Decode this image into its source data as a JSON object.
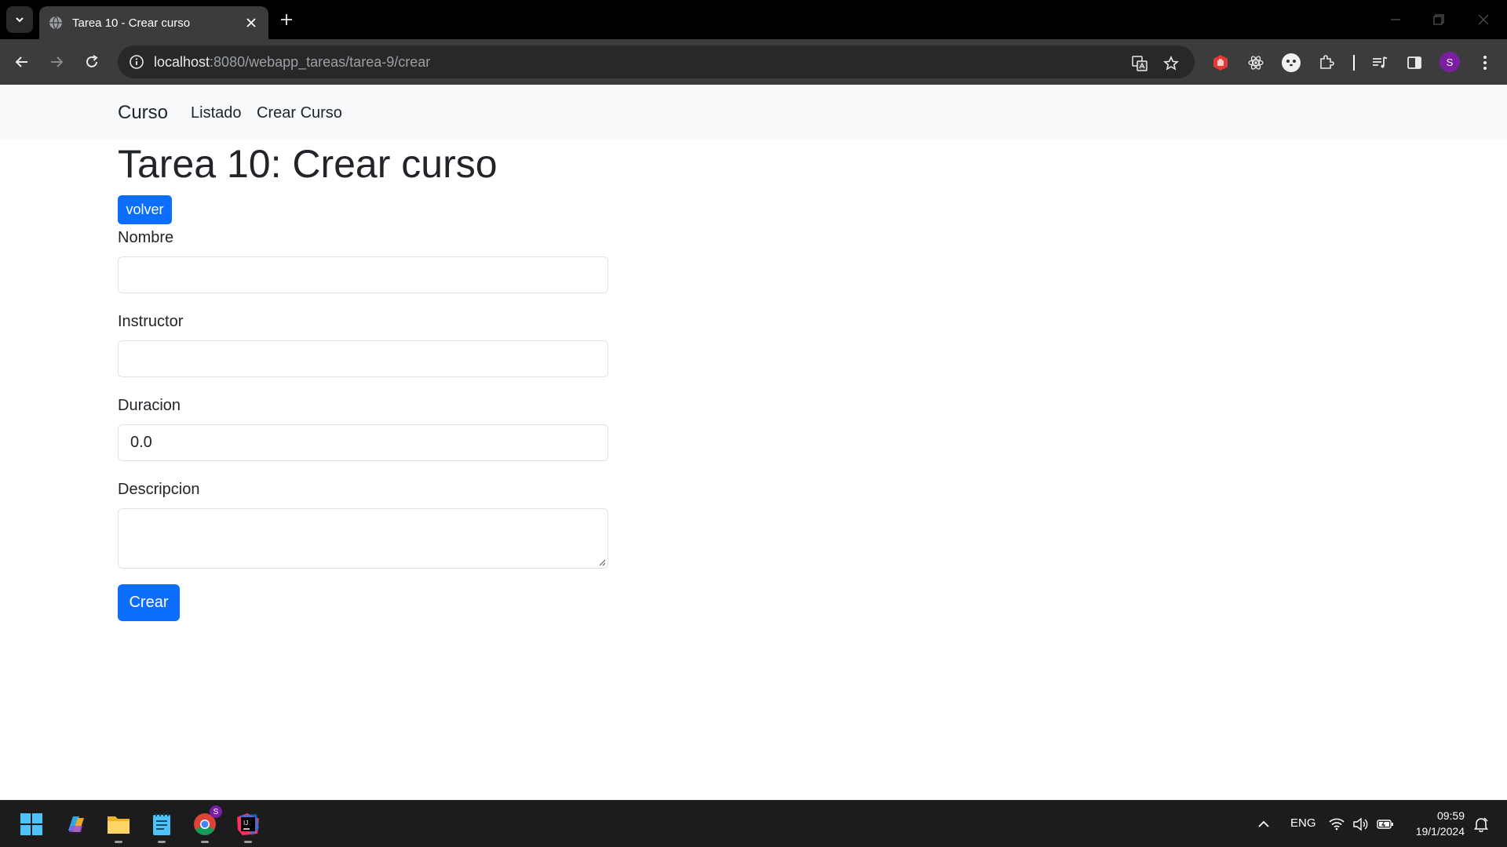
{
  "browser": {
    "tab_title": "Tarea 10 - Crear curso",
    "url_host": "localhost",
    "url_rest": ":8080/webapp_tareas/tarea-9/crear",
    "profile_initial": "S"
  },
  "navbar": {
    "brand": "Curso",
    "links": [
      "Listado",
      "Crear Curso"
    ]
  },
  "page": {
    "title": "Tarea 10: Crear curso",
    "back_button": "volver"
  },
  "form": {
    "nombre_label": "Nombre",
    "nombre_value": "",
    "instructor_label": "Instructor",
    "instructor_value": "",
    "duracion_label": "Duracion",
    "duracion_value": "0.0",
    "descripcion_label": "Descripcion",
    "descripcion_value": "",
    "submit_label": "Crear"
  },
  "taskbar": {
    "language": "ENG",
    "time": "09:59",
    "date": "19/1/2024",
    "chrome_badge": "S"
  },
  "colors": {
    "primary": "#0d6efd",
    "navbar_bg": "#f8f9fa",
    "tab_strip": "#000000",
    "toolbar": "#3c3c3c"
  }
}
